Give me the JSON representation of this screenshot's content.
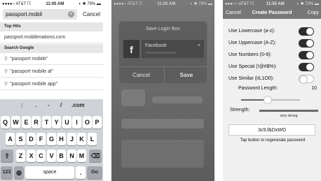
{
  "panel1": {
    "status": {
      "carrier": "●●●●○ AT&T ☈",
      "time": "11:05 AM",
      "battery": "◐ ✱ 79% ▬"
    },
    "search": {
      "value": "passport.mobil",
      "clear_icon": "×",
      "cancel_label": "Cancel"
    },
    "top_hits_header": "Top Hits",
    "top_hit": "passport.mobilenations.com",
    "google_header": "Search Google",
    "suggestions": [
      "\"passport mobile\"",
      "\"passport mobile al\"",
      "\"passport mobile app\""
    ],
    "keyboard": {
      "symbols": [
        ":",
        ".",
        "-",
        "/",
        ".com"
      ],
      "row1": [
        "Q",
        "W",
        "E",
        "R",
        "T",
        "Y",
        "U",
        "I",
        "O",
        "P"
      ],
      "row2": [
        "A",
        "S",
        "D",
        "F",
        "G",
        "H",
        "J",
        "K",
        "L"
      ],
      "row3": [
        "Z",
        "X",
        "C",
        "V",
        "B",
        "N",
        "M"
      ],
      "shift": "⇧",
      "backspace": "⌫",
      "numbers": "123",
      "globe": "◍",
      "space": "space",
      "period": ".",
      "go": "Go"
    }
  },
  "panel2": {
    "status": {
      "carrier": "●●●●○ AT&T ☈",
      "time": "11:05 AM",
      "battery": "◐ ✱ 79% ▬"
    },
    "dialog": {
      "title": "Save Login Box",
      "site_icon": "f",
      "site_field": "Facebook",
      "clear_icon": "×",
      "cancel_label": "Cancel",
      "save_label": "Save"
    }
  },
  "panel3": {
    "status": {
      "carrier": "●●●○○ AT&T ☈",
      "time": "11:55 AM",
      "battery": "◐ ✱ 72% ▬"
    },
    "nav": {
      "cancel_label": "Cancel",
      "title": "Create Password",
      "copy_label": "Copy"
    },
    "options": [
      {
        "label": "Use Lowercase (a-z):",
        "on": true
      },
      {
        "label": "Use Uppercase (A-Z):",
        "on": true
      },
      {
        "label": "Use Numbers (0-9):",
        "on": true
      },
      {
        "label": "Use Special (!@#$%):",
        "on": true
      },
      {
        "label": "Use Similar (iIL1O0):",
        "on": false
      }
    ],
    "length_label": "Password Length:",
    "length_value": "10",
    "length_fraction": 0.45,
    "strength_label": "Strength:",
    "strength_fraction": 1.0,
    "strength_text": "very strong",
    "password": "3c9,f&DxWD",
    "hint": "Tap button to regenerate password"
  }
}
